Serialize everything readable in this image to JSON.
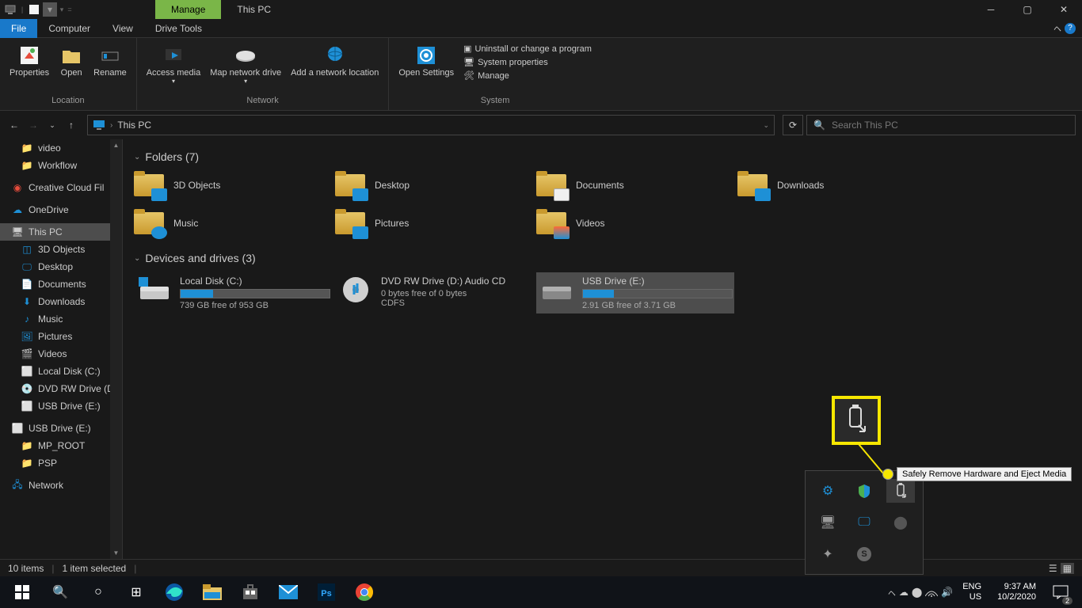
{
  "title_bar": {
    "manage_tab": "Manage",
    "title": "This PC"
  },
  "menu": {
    "file": "File",
    "computer": "Computer",
    "view": "View",
    "drive_tools": "Drive Tools"
  },
  "ribbon": {
    "location": {
      "properties": "Properties",
      "open": "Open",
      "rename": "Rename",
      "label": "Location"
    },
    "network": {
      "access_media": "Access media",
      "map_drive": "Map network drive",
      "add_location": "Add a network location",
      "label": "Network"
    },
    "system": {
      "open_settings": "Open Settings",
      "uninstall": "Uninstall or change a program",
      "sys_props": "System properties",
      "manage": "Manage",
      "label": "System"
    }
  },
  "nav": {
    "breadcrumb": "This PC",
    "search_placeholder": "Search This PC"
  },
  "sidebar": {
    "items": [
      {
        "label": "video",
        "icon": "folder"
      },
      {
        "label": "Workflow",
        "icon": "folder"
      }
    ],
    "cc": "Creative Cloud Fil",
    "onedrive": "OneDrive",
    "thispc": "This PC",
    "pc_children": [
      {
        "label": "3D Objects",
        "icon": "obj"
      },
      {
        "label": "Desktop",
        "icon": "desktop"
      },
      {
        "label": "Documents",
        "icon": "doc"
      },
      {
        "label": "Downloads",
        "icon": "dl"
      },
      {
        "label": "Music",
        "icon": "music"
      },
      {
        "label": "Pictures",
        "icon": "pic"
      },
      {
        "label": "Videos",
        "icon": "vid"
      },
      {
        "label": "Local Disk (C:)",
        "icon": "disk"
      },
      {
        "label": "DVD RW Drive (D",
        "icon": "dvd"
      },
      {
        "label": "USB Drive (E:)",
        "icon": "usb"
      }
    ],
    "usb_root": "USB Drive (E:)",
    "usb_children": [
      {
        "label": "MP_ROOT"
      },
      {
        "label": "PSP"
      }
    ],
    "network": "Network"
  },
  "main": {
    "folders_header": "Folders (7)",
    "folders": [
      {
        "label": "3D Objects",
        "overlay": "#1e90d6"
      },
      {
        "label": "Desktop",
        "overlay": "#1e90d6"
      },
      {
        "label": "Documents",
        "overlay": "#f0f0f0"
      },
      {
        "label": "Downloads",
        "overlay": "#1e90d6"
      },
      {
        "label": "Music",
        "overlay": "#1e90d6"
      },
      {
        "label": "Pictures",
        "overlay": "#1e90d6"
      },
      {
        "label": "Videos",
        "overlay": "#ff6b35"
      }
    ],
    "drives_header": "Devices and drives (3)",
    "drives": {
      "c": {
        "name": "Local Disk (C:)",
        "free": "739 GB free of 953 GB",
        "pct": 22
      },
      "d": {
        "name": "DVD RW Drive (D:) Audio CD",
        "line1": "0 bytes free of 0 bytes",
        "line2": "CDFS"
      },
      "e": {
        "name": "USB Drive (E:)",
        "free": "2.91 GB free of 3.71 GB",
        "pct": 21
      }
    }
  },
  "status": {
    "items": "10 items",
    "selected": "1 item selected"
  },
  "tooltip": "Safely Remove Hardware and Eject Media",
  "taskbar": {
    "lang1": "ENG",
    "lang2": "US",
    "time": "9:37 AM",
    "date": "10/2/2020",
    "notif": "2"
  }
}
